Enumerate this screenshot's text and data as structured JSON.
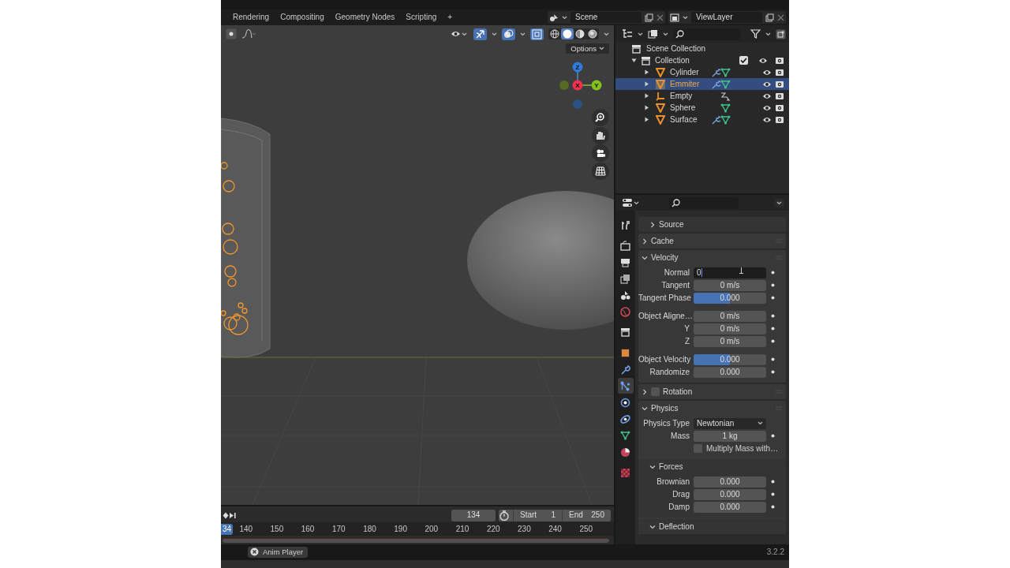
{
  "workspace_tabs": [
    "Rendering",
    "Compositing",
    "Geometry Nodes",
    "Scripting"
  ],
  "add_tab": "+",
  "scene": "Scene",
  "view_layer": "ViewLayer",
  "viewport": {
    "toggles": [
      {
        "kind": "gizmos",
        "on": true
      },
      {
        "kind": "overlays",
        "on": true
      },
      {
        "kind": "xray",
        "on": true
      }
    ],
    "shading_modes": [
      {
        "kind": "wireframe",
        "selected": false
      },
      {
        "kind": "solid",
        "selected": true
      },
      {
        "kind": "material",
        "selected": false
      },
      {
        "kind": "rendered",
        "selected": false
      }
    ],
    "options": "Options",
    "axes": [
      "Z",
      "X",
      "Y"
    ]
  },
  "outliner": {
    "root": "Scene Collection",
    "collection": {
      "label": "Collection",
      "expanded": true,
      "checked": true,
      "children": [
        {
          "label": "Cylinder",
          "kind": "mesh",
          "expanded": false,
          "selected": false,
          "modifiers": true
        },
        {
          "label": "Emmiter",
          "kind": "mesh",
          "expanded": false,
          "selected": true,
          "modifiers": true
        },
        {
          "label": "Empty",
          "kind": "empty",
          "expanded": false,
          "selected": false,
          "modifiers": false
        },
        {
          "label": "Sphere",
          "kind": "mesh",
          "expanded": false,
          "selected": false,
          "modifiers": false
        },
        {
          "label": "Surface",
          "kind": "mesh",
          "expanded": false,
          "selected": false,
          "modifiers": true
        }
      ]
    }
  },
  "properties": {
    "tabs": [
      [
        {
          "kind": "tool",
          "selected": false
        }
      ],
      [
        {
          "kind": "render",
          "selected": false
        },
        {
          "kind": "output",
          "selected": false
        },
        {
          "kind": "view_layer",
          "selected": false
        },
        {
          "kind": "scene",
          "selected": false
        },
        {
          "kind": "world",
          "selected": false
        }
      ],
      [
        {
          "kind": "collection",
          "selected": false
        }
      ],
      [
        {
          "kind": "object",
          "selected": false
        },
        {
          "kind": "modifier",
          "selected": false
        },
        {
          "kind": "particles",
          "selected": true
        },
        {
          "kind": "physics",
          "selected": false
        },
        {
          "kind": "constraints",
          "selected": false
        },
        {
          "kind": "data",
          "selected": false
        },
        {
          "kind": "material",
          "selected": false
        }
      ],
      [
        {
          "kind": "texture",
          "selected": false
        }
      ]
    ],
    "sections": [
      {
        "kind": "subpanel",
        "title": "Source",
        "expanded": false
      },
      {
        "kind": "panel",
        "title": "Cache",
        "expanded": false
      },
      {
        "kind": "panel",
        "title": "Velocity",
        "expanded": true,
        "groups": [
          [
            {
              "kind": "edit",
              "label": "Normal",
              "value": "0"
            },
            {
              "kind": "number",
              "label": "Tangent",
              "value": "0 m/s"
            },
            {
              "kind": "slider",
              "label": "Tangent Phase",
              "value": "0.000",
              "level": 0.5
            }
          ],
          [
            {
              "kind": "number",
              "label": "Object Aligne…",
              "value": "0 m/s"
            },
            {
              "kind": "number",
              "label": "Y",
              "value": "0 m/s"
            },
            {
              "kind": "number",
              "label": "Z",
              "value": "0 m/s"
            }
          ],
          [
            {
              "kind": "slider",
              "label": "Object Velocity",
              "value": "0.000",
              "level": 0.5
            },
            {
              "kind": "number",
              "label": "Randomize",
              "value": "0.000"
            }
          ]
        ]
      },
      {
        "kind": "panel",
        "title": "Rotation",
        "expanded": false,
        "checked": false
      },
      {
        "kind": "panel",
        "title": "Physics",
        "expanded": true,
        "groups": [
          [
            {
              "kind": "dropdown",
              "label": "Physics Type",
              "value": "Newtonian"
            },
            {
              "kind": "number",
              "label": "Mass",
              "value": "1 kg"
            },
            {
              "kind": "checkbox",
              "label": "Multiply Mass with…",
              "checked": false
            }
          ]
        ],
        "children": [
          {
            "kind": "subpanel",
            "title": "Forces",
            "expanded": true,
            "groups": [
              [
                {
                  "kind": "number",
                  "label": "Brownian",
                  "value": "0.000"
                },
                {
                  "kind": "number",
                  "label": "Drag",
                  "value": "0.000"
                },
                {
                  "kind": "number",
                  "label": "Damp",
                  "value": "0.000"
                }
              ]
            ]
          },
          {
            "kind": "subpanel",
            "title": "Deflection",
            "expanded": true
          }
        ]
      }
    ]
  },
  "timeline": {
    "playhead": "34",
    "frames": [
      "140",
      "150",
      "160",
      "170",
      "180",
      "190",
      "200",
      "210",
      "220",
      "230",
      "240",
      "250"
    ],
    "current_frame": "134",
    "start_label": "Start",
    "start": "1",
    "end_label": "End",
    "end": "250"
  },
  "status_bar": {
    "button": "Anim Player",
    "version": "3.2.2"
  }
}
